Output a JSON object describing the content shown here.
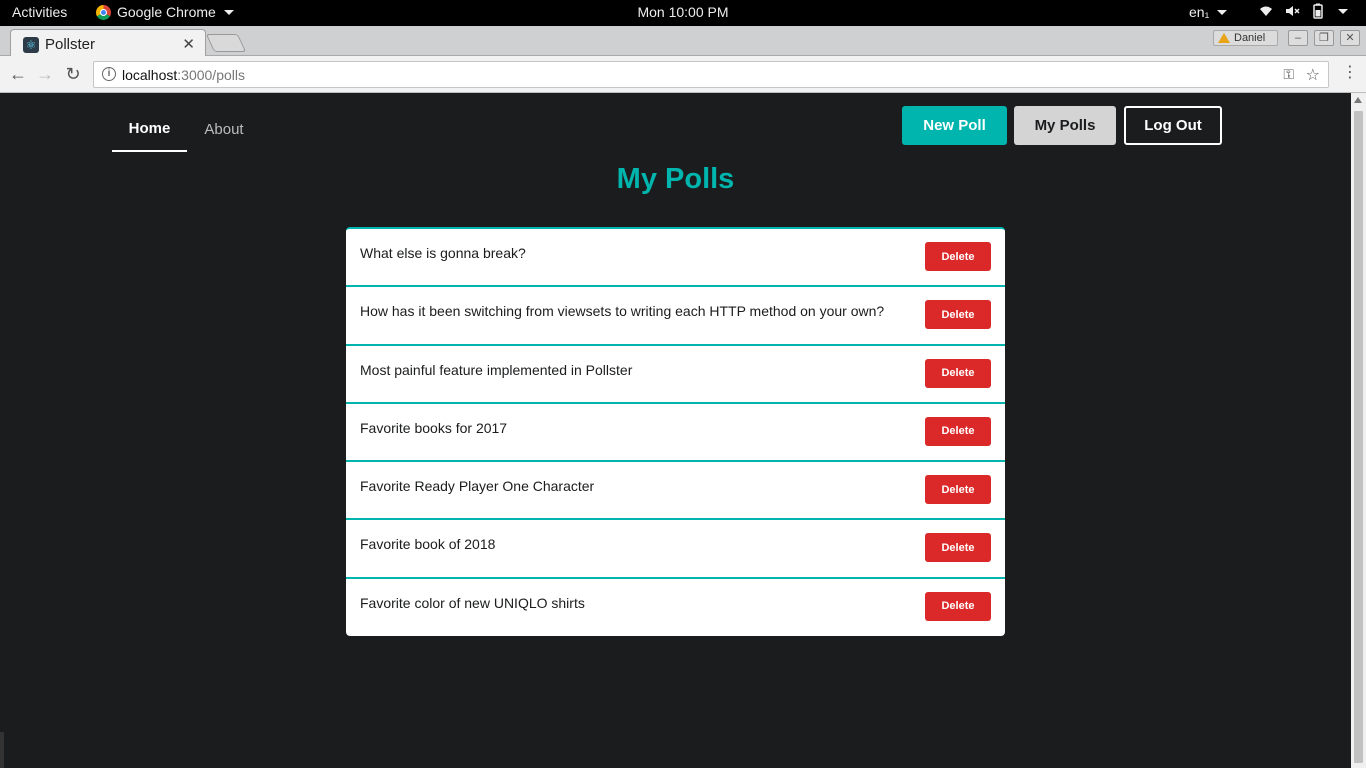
{
  "system": {
    "activities": "Activities",
    "app_name": "Google Chrome",
    "clock": "Mon 10:00 PM",
    "language": "en₁"
  },
  "browser": {
    "tab_title": "Pollster",
    "profile_name": "Daniel",
    "url_host": "localhost",
    "url_path": ":3000/polls"
  },
  "nav": {
    "home": "Home",
    "about": "About"
  },
  "actions": {
    "new_poll": "New Poll",
    "my_polls": "My Polls",
    "log_out": "Log Out"
  },
  "page_title": "My Polls",
  "polls": [
    {
      "question": "What else is gonna break?",
      "delete": "Delete"
    },
    {
      "question": "How has it been switching from viewsets to writing each HTTP method on your own?",
      "delete": "Delete"
    },
    {
      "question": "Most painful feature implemented in Pollster",
      "delete": "Delete"
    },
    {
      "question": "Favorite books for 2017",
      "delete": "Delete"
    },
    {
      "question": "Favorite Ready Player One Character",
      "delete": "Delete"
    },
    {
      "question": "Favorite book of 2018",
      "delete": "Delete"
    },
    {
      "question": "Favorite color of new UNIQLO shirts",
      "delete": "Delete"
    }
  ],
  "colors": {
    "accent": "#00b5ad",
    "danger": "#db2828",
    "background": "#1b1c1d"
  }
}
